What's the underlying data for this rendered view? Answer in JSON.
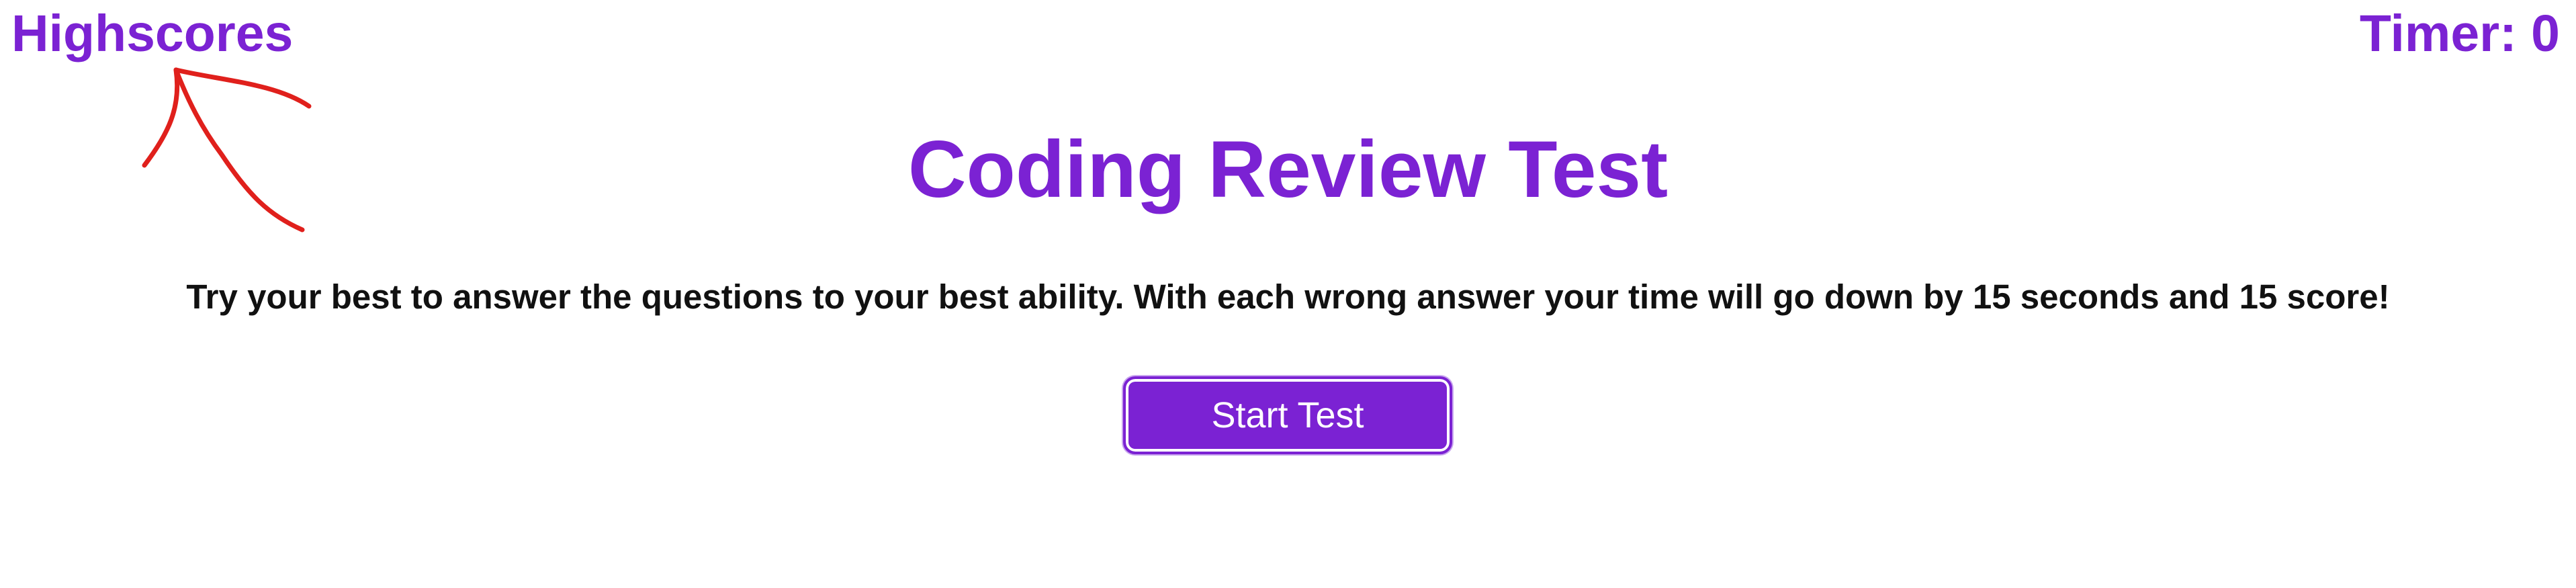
{
  "header": {
    "highscores_label": "Highscores",
    "timer_label": "Timer: 0"
  },
  "main": {
    "title": "Coding Review Test",
    "instructions": "Try your best to answer the questions to your best ability. With each wrong answer your time will go down by 15 seconds and 15 score!",
    "start_button_label": "Start Test"
  },
  "colors": {
    "accent": "#7b22d3",
    "text": "#111111",
    "annotation": "#e0201c",
    "background": "#ffffff"
  },
  "annotations": {
    "arrow_icon": "hand-drawn-arrow-icon"
  }
}
